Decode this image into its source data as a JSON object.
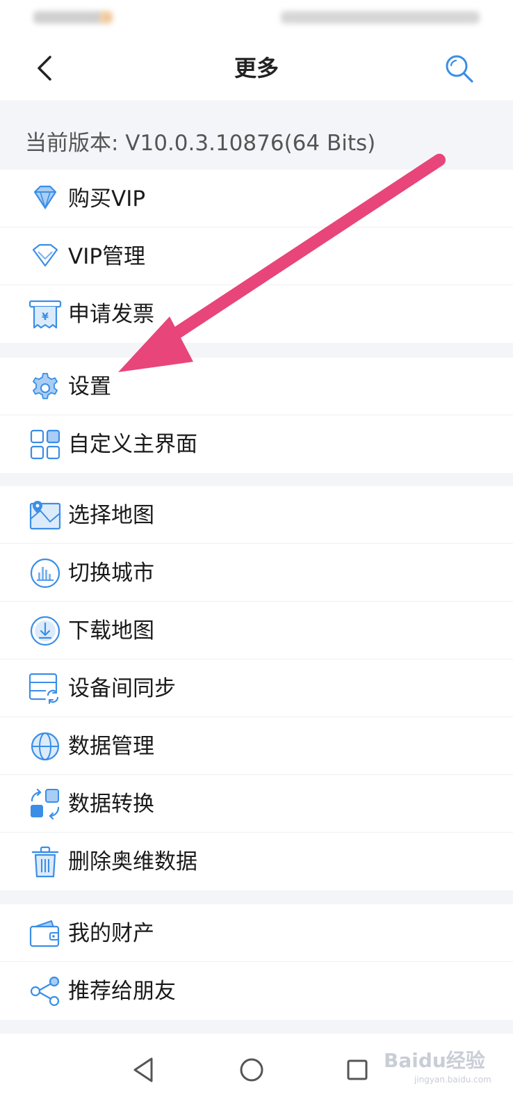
{
  "header": {
    "title": "更多"
  },
  "version": {
    "text": "当前版本: V10.0.3.10876(64 Bits)"
  },
  "groups": [
    {
      "items": [
        {
          "label": "购买VIP",
          "icon": "diamond-icon"
        },
        {
          "label": "VIP管理",
          "icon": "diamond-outline-icon"
        },
        {
          "label": "申请发票",
          "icon": "invoice-icon"
        }
      ]
    },
    {
      "items": [
        {
          "label": "设置",
          "icon": "gear-icon"
        },
        {
          "label": "自定义主界面",
          "icon": "grid-icon"
        }
      ]
    },
    {
      "items": [
        {
          "label": "选择地图",
          "icon": "map-icon"
        },
        {
          "label": "切换城市",
          "icon": "city-icon"
        },
        {
          "label": "下载地图",
          "icon": "download-icon"
        },
        {
          "label": "设备间同步",
          "icon": "sync-icon"
        },
        {
          "label": "数据管理",
          "icon": "globe-icon"
        },
        {
          "label": "数据转换",
          "icon": "convert-icon"
        },
        {
          "label": "删除奥维数据",
          "icon": "trash-icon"
        }
      ]
    },
    {
      "items": [
        {
          "label": "我的财产",
          "icon": "wallet-icon"
        },
        {
          "label": "推荐给朋友",
          "icon": "share-icon"
        }
      ]
    }
  ],
  "watermark": {
    "text": "Baidu经验",
    "url": "jingyan.baidu.com"
  },
  "colors": {
    "icon_blue": "#3a8ee6",
    "icon_light": "#a9cdf5",
    "arrow": "#e8457a"
  }
}
